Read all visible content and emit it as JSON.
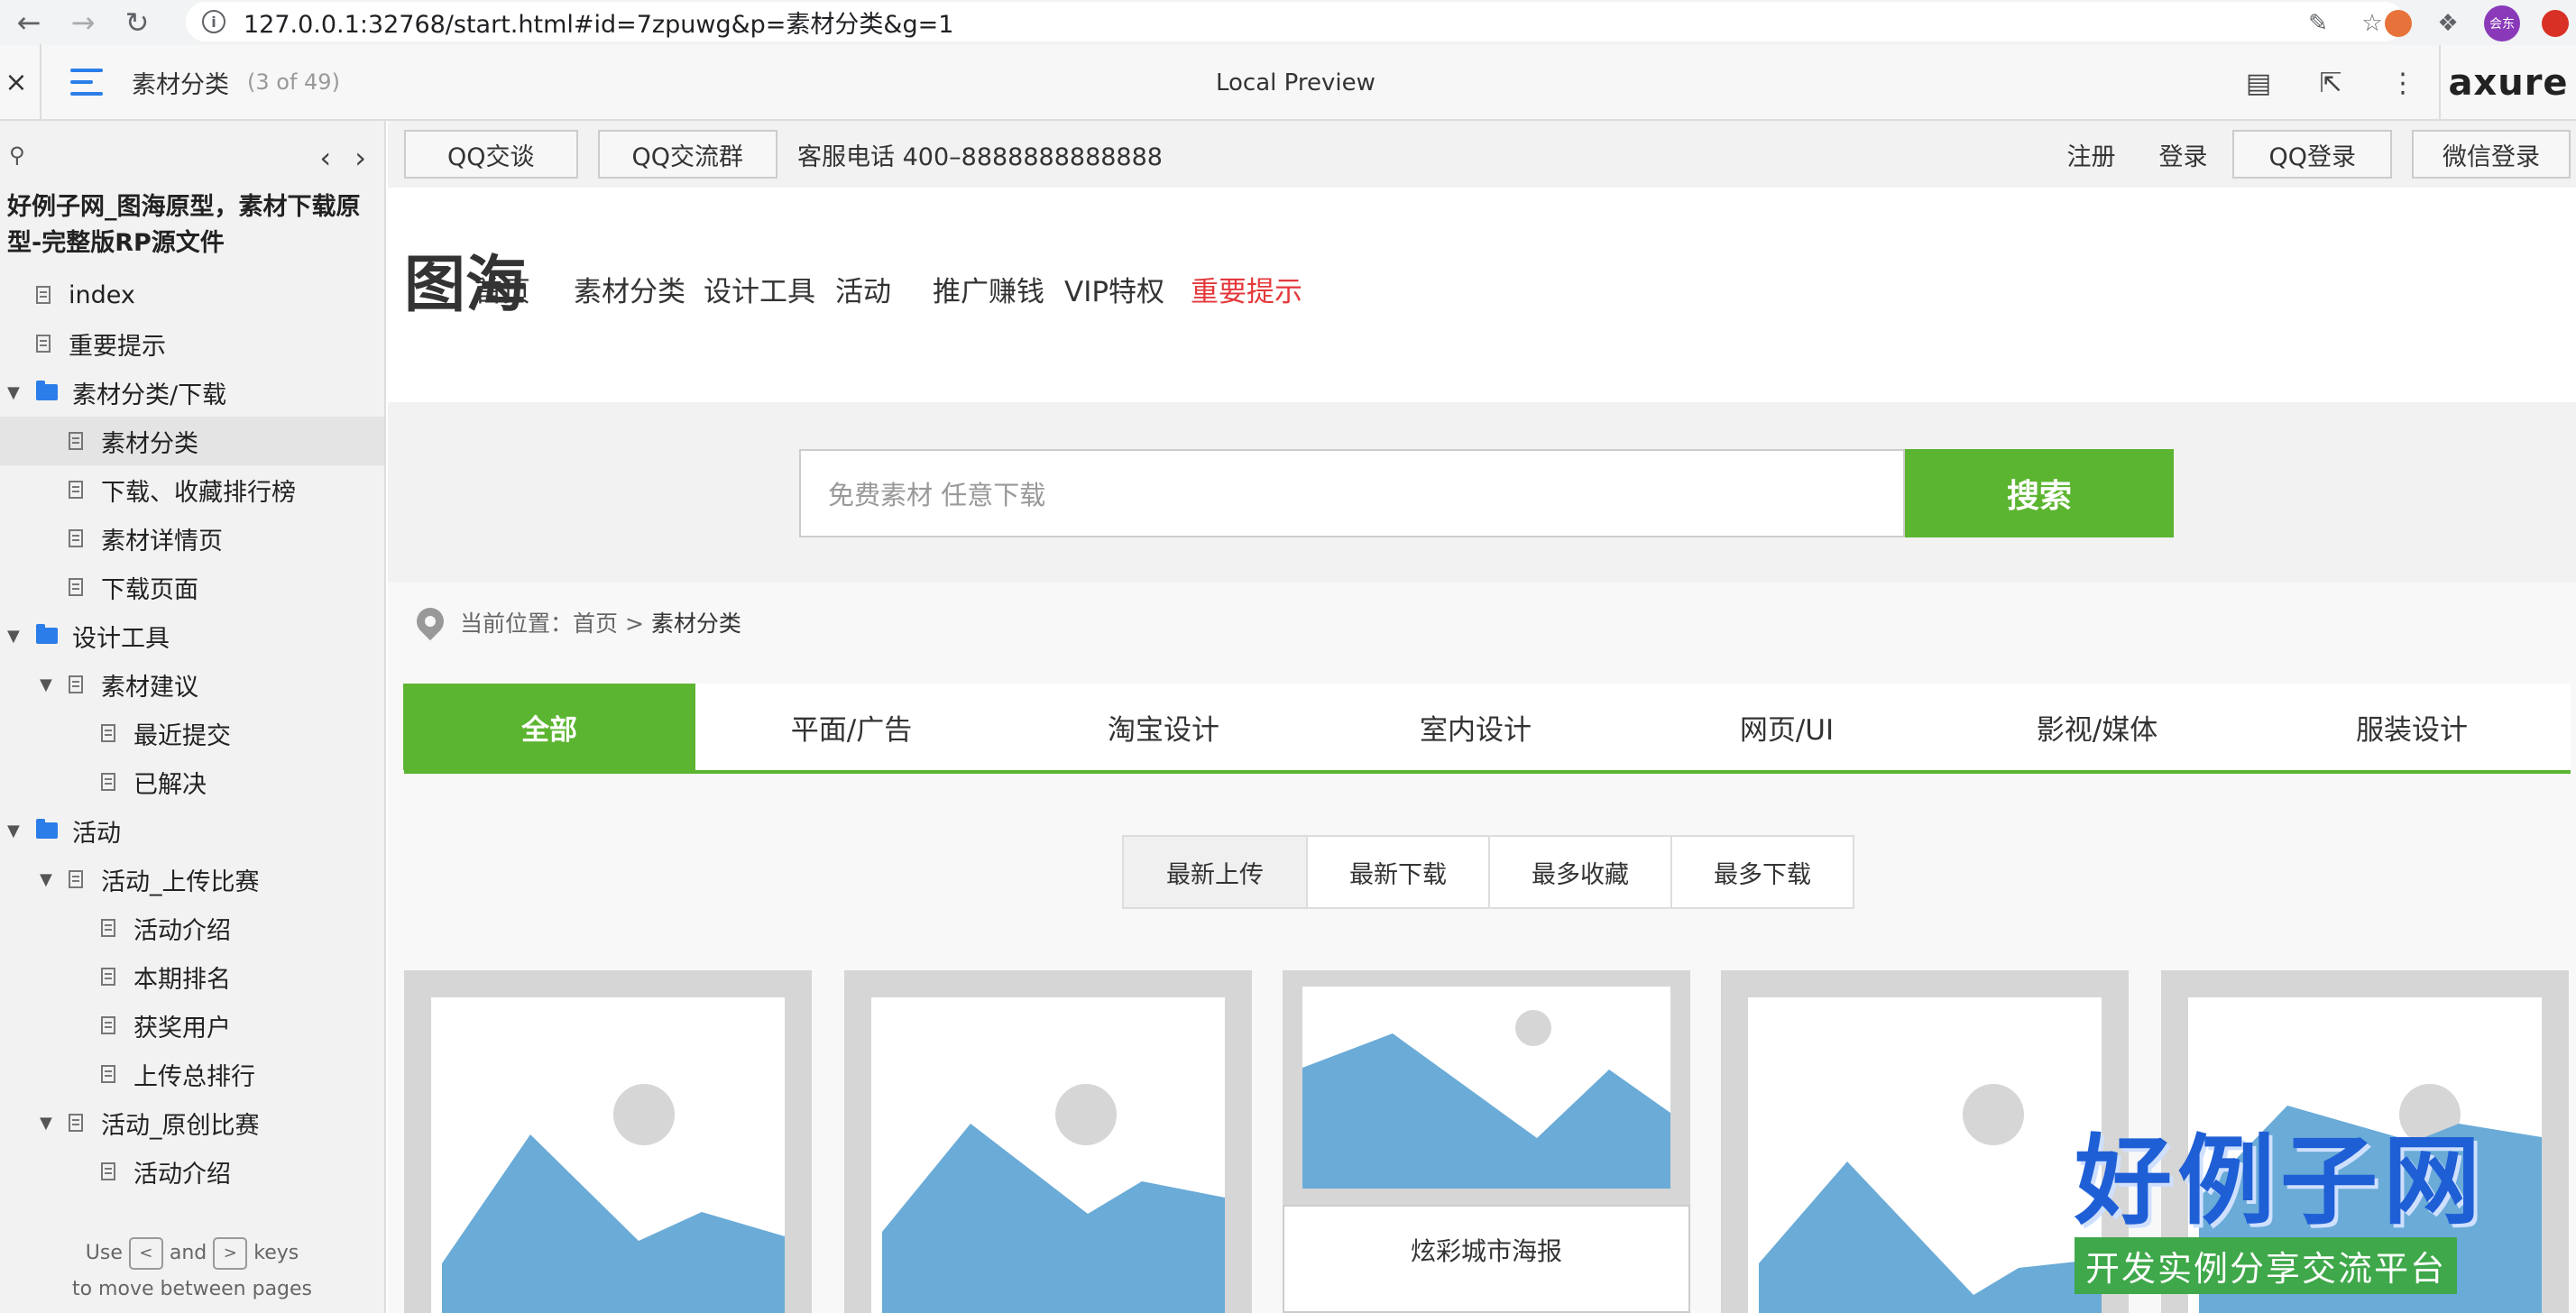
{
  "browser": {
    "back_icon": "arrow-left-icon",
    "forward_icon": "arrow-right-icon",
    "reload_icon": "reload-icon",
    "url": "127.0.0.1:32768/start.html#id=7zpuwg&p=素材分类&g=1",
    "avatar_label": "会东"
  },
  "axure": {
    "page_title": "素材分类",
    "page_count": "(3 of 49)",
    "center_label": "Local Preview",
    "logo": "axure"
  },
  "sidebar": {
    "project_title": "好例子网_图海原型，素材下载原型-完整版RP源文件",
    "items": [
      {
        "label": "index",
        "type": "page",
        "level": 0,
        "expanded": false,
        "selected": false
      },
      {
        "label": "重要提示",
        "type": "page",
        "level": 0,
        "expanded": false,
        "selected": false
      },
      {
        "label": "素材分类/下载",
        "type": "folder",
        "level": 0,
        "expanded": true,
        "selected": false
      },
      {
        "label": "素材分类",
        "type": "page",
        "level": 1,
        "expanded": false,
        "selected": true
      },
      {
        "label": "下载、收藏排行榜",
        "type": "page",
        "level": 1,
        "expanded": false,
        "selected": false
      },
      {
        "label": "素材详情页",
        "type": "page",
        "level": 1,
        "expanded": false,
        "selected": false
      },
      {
        "label": "下载页面",
        "type": "page",
        "level": 1,
        "expanded": false,
        "selected": false
      },
      {
        "label": "设计工具",
        "type": "folder",
        "level": 0,
        "expanded": true,
        "selected": false
      },
      {
        "label": "素材建议",
        "type": "page",
        "level": 1,
        "expanded": true,
        "selected": false
      },
      {
        "label": "最近提交",
        "type": "page",
        "level": 2,
        "expanded": false,
        "selected": false
      },
      {
        "label": "已解决",
        "type": "page",
        "level": 2,
        "expanded": false,
        "selected": false
      },
      {
        "label": "活动",
        "type": "folder",
        "level": 0,
        "expanded": true,
        "selected": false
      },
      {
        "label": "活动_上传比赛",
        "type": "page",
        "level": 1,
        "expanded": true,
        "selected": false
      },
      {
        "label": "活动介绍",
        "type": "page",
        "level": 2,
        "expanded": false,
        "selected": false
      },
      {
        "label": "本期排名",
        "type": "page",
        "level": 2,
        "expanded": false,
        "selected": false
      },
      {
        "label": "获奖用户",
        "type": "page",
        "level": 2,
        "expanded": false,
        "selected": false
      },
      {
        "label": "上传总排行",
        "type": "page",
        "level": 2,
        "expanded": false,
        "selected": false
      },
      {
        "label": "活动_原创比赛",
        "type": "page",
        "level": 1,
        "expanded": true,
        "selected": false
      },
      {
        "label": "活动介绍",
        "type": "page",
        "level": 2,
        "expanded": false,
        "selected": false
      }
    ],
    "footer": {
      "use": "Use",
      "prev_key": "<",
      "and": "and",
      "next_key": ">",
      "keys": "keys",
      "line2": "to move between pages"
    }
  },
  "site": {
    "topbar": {
      "qq_chat": "QQ交谈",
      "qq_group": "QQ交流群",
      "phone": "客服电话 400–8888888888888",
      "register": "注册",
      "login": "登录",
      "qq_login": "QQ登录",
      "wechat_login": "微信登录"
    },
    "logo": "图海",
    "nav": [
      "首页",
      "素材分类",
      "设计工具",
      "活动",
      "推广赚钱",
      "VIP特权",
      "重要提示"
    ],
    "search": {
      "placeholder": "免费素材 任意下载",
      "button": "搜索"
    },
    "breadcrumb": {
      "prefix": "当前位置：",
      "home": "首页",
      "sep": ">",
      "current": "素材分类"
    },
    "categories": [
      "全部",
      "平面/广告",
      "淘宝设计",
      "室内设计",
      "网页/UI",
      "影视/媒体",
      "服装设计"
    ],
    "sort": [
      "最新上传",
      "最新下载",
      "最多收藏",
      "最多下载"
    ],
    "card_caption": "炫彩城市海报"
  },
  "watermark": {
    "big": "好例子网",
    "small": "开发实例分享交流平台"
  },
  "colors": {
    "accent_green": "#5cb531",
    "important_red": "#e4393c",
    "axure_blue": "#2b7de9",
    "placeholder_blue": "#6aabd7",
    "placeholder_gray": "#d6d6d6"
  }
}
